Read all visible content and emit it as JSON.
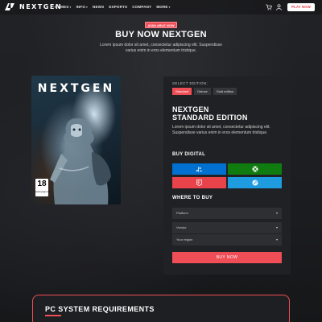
{
  "nav": {
    "logo_text": "NEXTGEN",
    "links": [
      {
        "label": "GAMES",
        "has_dropdown": true
      },
      {
        "label": "INFO",
        "has_dropdown": true
      },
      {
        "label": "NEWS",
        "has_dropdown": false
      },
      {
        "label": "ESPORTS",
        "has_dropdown": false
      },
      {
        "label": "COMPANY",
        "has_dropdown": false
      },
      {
        "label": "MORE",
        "has_dropdown": true
      }
    ],
    "play_now": "PLAY NOW"
  },
  "hero": {
    "badge": "AVAILABLE NOW",
    "title": "BUY NOW NEXTGEN",
    "description": "Lorem ipsum dolor sit amet, consectetur adipiscing elit. Suspendisse varius enim in eros elementum tristique."
  },
  "cover": {
    "title": "NEXTGEN",
    "pegi_rating": "18",
    "pegi_sub": "www.pegi.info"
  },
  "purchase": {
    "select_label": "SELECT EDITION:",
    "editions": [
      {
        "label": "Standard",
        "active": true
      },
      {
        "label": "Deluxe",
        "active": false
      },
      {
        "label": "Gold edition",
        "active": false
      }
    ],
    "edition_title_line1": "NEXTGEN",
    "edition_title_line2": "STANDARD EDITION",
    "edition_desc": "Lorem ipsum dolor sit amet, consectetur adipiscing elit. Suspendisse varius enim in eros elementum tristique.",
    "buy_digital_label": "BUY DIGITAL",
    "platforms": [
      {
        "name": "playstation-icon",
        "color": "#0070d1"
      },
      {
        "name": "xbox-icon",
        "color": "#107c10"
      },
      {
        "name": "epic-games-icon",
        "color": "#e8434b"
      },
      {
        "name": "steam-icon",
        "color": "#1f9ce0"
      }
    ],
    "where_to_buy_label": "WHERE TO BUY",
    "dropdowns": [
      {
        "value": "Platform"
      },
      {
        "value": "Vendor"
      },
      {
        "value": "Your region"
      }
    ],
    "buy_now": "BUY NOW"
  },
  "requirements": {
    "title": "PC SYSTEM REQUIREMENTS"
  },
  "colors": {
    "accent": "#ef4e57",
    "background": "#1b1c1f",
    "panel": "#202124"
  }
}
